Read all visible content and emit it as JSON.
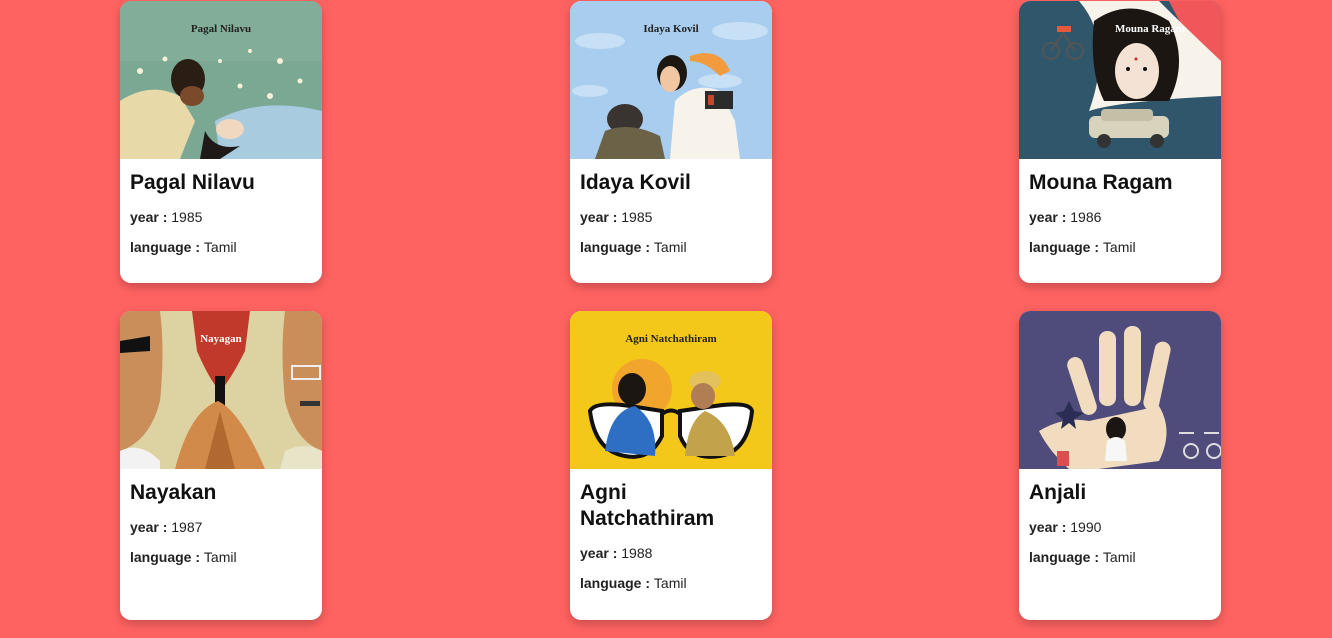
{
  "labels": {
    "year": "year : ",
    "language": "language : "
  },
  "movies": [
    {
      "title": "Pagal Nilavu",
      "year": "1985",
      "language": "Tamil",
      "poster_caption": "Pagal Nilavu",
      "poster_icon": "poster-couple-flowers"
    },
    {
      "title": "Idaya Kovil",
      "year": "1985",
      "language": "Tamil",
      "poster_caption": "Idaya Kovil",
      "poster_icon": "poster-mother-child"
    },
    {
      "title": "Mouna Ragam",
      "year": "1986",
      "language": "Tamil",
      "poster_caption": "Mouna Ragam",
      "poster_icon": "poster-woman-car"
    },
    {
      "title": "Nayakan",
      "year": "1987",
      "language": "Tamil",
      "poster_caption": "Nayagan",
      "poster_icon": "poster-faces-gun"
    },
    {
      "title": "Agni Natchathiram",
      "year": "1988",
      "language": "Tamil",
      "poster_caption": "Agni Natchathiram",
      "poster_icon": "poster-glasses-faces"
    },
    {
      "title": "Anjali",
      "year": "1990",
      "language": "Tamil",
      "poster_caption": "",
      "poster_icon": "poster-hand-girl"
    }
  ],
  "colors": {
    "background": "#ff6361",
    "card": "#ffffff"
  }
}
